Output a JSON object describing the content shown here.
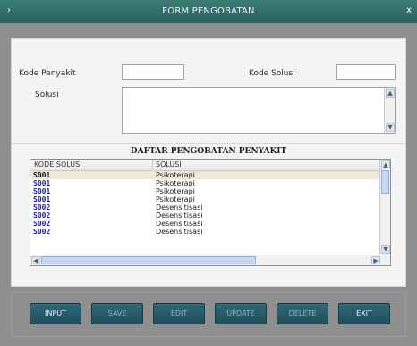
{
  "window": {
    "title": "FORM PENGOBATAN",
    "sys_icon": "›",
    "close_icon": "x"
  },
  "form": {
    "kode_penyakit_label": "Kode Penyakit",
    "kode_penyakit_value": "",
    "kode_solusi_label": "Kode Solusi",
    "kode_solusi_value": "",
    "solusi_label": "Solusi",
    "solusi_value": ""
  },
  "list": {
    "title": "DAFTAR PENGOBATAN PENYAKIT",
    "columns": [
      "KODE SOLUSI",
      "SOLUSI"
    ],
    "rows": [
      {
        "kode": "S001",
        "solusi": "Psikoterapi"
      },
      {
        "kode": "S001",
        "solusi": "Psikoterapi"
      },
      {
        "kode": "S001",
        "solusi": "Psikoterapi"
      },
      {
        "kode": "S001",
        "solusi": "Psikoterapi"
      },
      {
        "kode": "S002",
        "solusi": "Desensitisasi"
      },
      {
        "kode": "S002",
        "solusi": "Desensitisasi"
      },
      {
        "kode": "S002",
        "solusi": "Desensitisasi"
      },
      {
        "kode": "S002",
        "solusi": "Desensitisasi"
      }
    ]
  },
  "buttons": {
    "input": "INPUT",
    "save": "SAVE",
    "edit": "EDIT",
    "update": "UPDATE",
    "delete": "DELETE",
    "exit": "EXIT"
  },
  "colors": {
    "titlebar": "#2f6f6a",
    "button": "#2a5f6f",
    "code_text": "#1a1ac0"
  }
}
